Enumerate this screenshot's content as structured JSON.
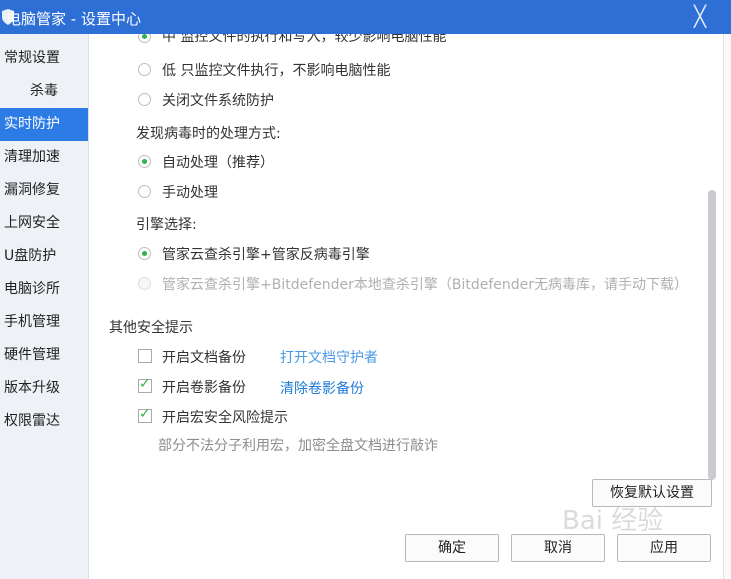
{
  "window": {
    "title": "电脑管家 - 设置中心",
    "close_glyph": "╳"
  },
  "sidebar": {
    "items": [
      {
        "label": "常规设置"
      },
      {
        "label": "杀毒"
      },
      {
        "label": "实时防护"
      },
      {
        "label": "清理加速"
      },
      {
        "label": "漏洞修复"
      },
      {
        "label": "上网安全"
      },
      {
        "label": "U盘防护"
      },
      {
        "label": "电脑诊所"
      },
      {
        "label": "手机管理"
      },
      {
        "label": "硬件管理"
      },
      {
        "label": "版本升级"
      },
      {
        "label": "权限雷达"
      }
    ],
    "active_index": 2
  },
  "realtime": {
    "partial_option": "中    监控文件的执行和写入，较少影响电脑性能",
    "monitor_options": [
      {
        "label": "低    只监控文件执行，不影响电脑性能",
        "selected": false
      },
      {
        "label": "关闭文件系统防护",
        "selected": false
      }
    ],
    "virus_handling": {
      "heading": "发现病毒时的处理方式:",
      "options": [
        {
          "label": "自动处理（推荐）",
          "selected": true
        },
        {
          "label": "手动处理",
          "selected": false
        }
      ]
    },
    "engine": {
      "heading": "引擎选择:",
      "options": [
        {
          "label": "管家云查杀引擎+管家反病毒引擎",
          "selected": true,
          "disabled": false
        },
        {
          "label": "管家云查杀引擎+Bitdefender本地查杀引擎（Bitdefender无病毒库，请手动下载）",
          "selected": false,
          "disabled": true
        }
      ]
    }
  },
  "other_tips": {
    "heading": "其他安全提示",
    "items": [
      {
        "label": "开启文档备份",
        "checked": false,
        "link": "打开文档守护者"
      },
      {
        "label": "开启卷影备份",
        "checked": true,
        "link": "清除卷影备份"
      },
      {
        "label": "开启宏安全风险提示",
        "checked": true
      }
    ],
    "hint": "部分不法分子利用宏，加密全盘文档进行敲诈"
  },
  "buttons": {
    "restore": "恢复默认设置",
    "ok": "确定",
    "cancel": "取消",
    "apply": "应用"
  },
  "watermark": "Bai 经验"
}
